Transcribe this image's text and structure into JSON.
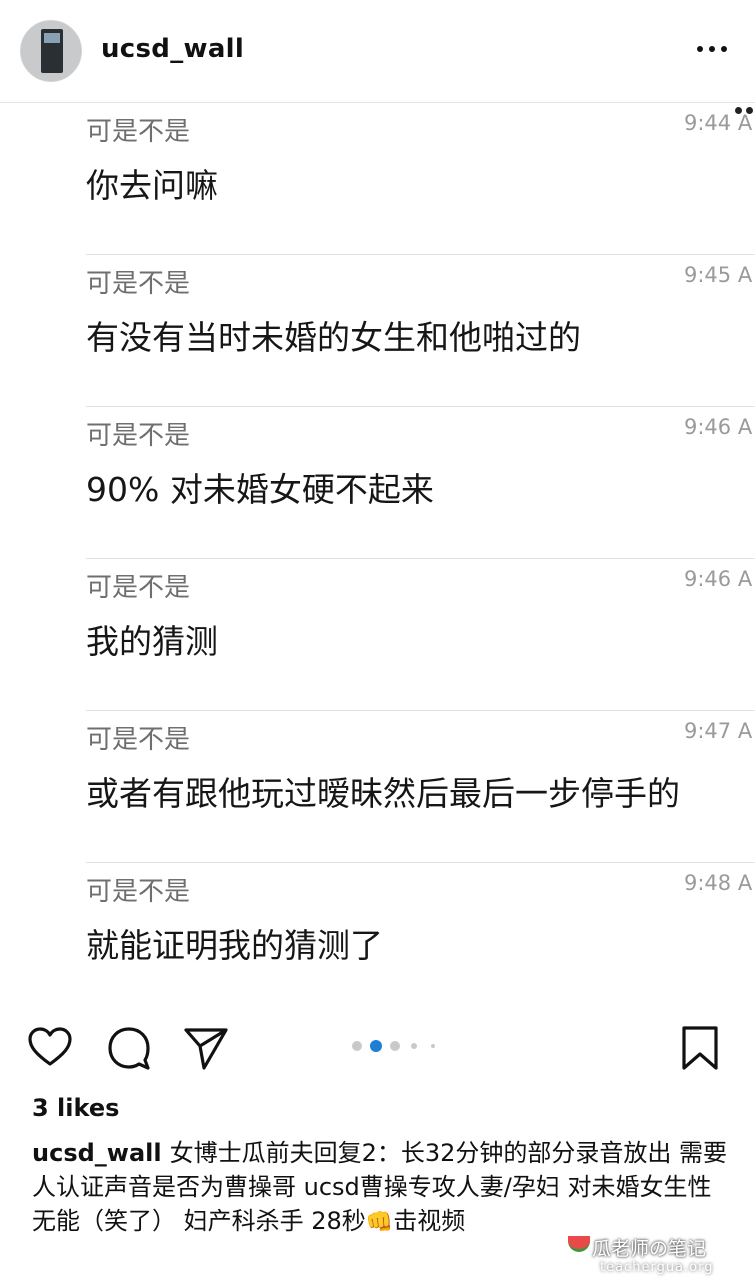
{
  "header": {
    "username": "ucsd_wall",
    "avatar_icon": "profile-photo",
    "more_icon": "more-horizontal-icon"
  },
  "chat": {
    "messages": [
      {
        "sender": "可是不是",
        "time": "9:44 A",
        "text": "你去问嘛"
      },
      {
        "sender": "可是不是",
        "time": "9:45 A",
        "text": "有没有当时未婚的女生和他啪过的"
      },
      {
        "sender": "可是不是",
        "time": "9:46 A",
        "text": "90% 对未婚女硬不起来"
      },
      {
        "sender": "可是不是",
        "time": "9:46 A",
        "text": "我的猜测"
      },
      {
        "sender": "可是不是",
        "time": "9:47 A",
        "text": "或者有跟他玩过暧昧然后最后一步停手的"
      },
      {
        "sender": "可是不是",
        "time": "9:48 A",
        "text": "就能证明我的猜测了"
      }
    ]
  },
  "actions": {
    "like_icon": "heart-icon",
    "comment_icon": "comment-icon",
    "share_icon": "send-icon",
    "save_icon": "bookmark-icon",
    "carousel_active_index": 2,
    "carousel_dots": 5
  },
  "post": {
    "likes": "3 likes",
    "caption_user": "ucsd_wall",
    "caption_text": "女博士瓜前夫回复2：长32分钟的部分录音放出 需要人认证声音是否为曹操哥 ucsd曹操专攻人妻/孕妇 对未婚女生性无能（笑了） 妇产科杀手 28秒",
    "caption_emoji": "👊",
    "caption_tail": "击视频"
  },
  "watermark": {
    "line1": "瓜老师の笔记",
    "line2": "teachergua.org"
  },
  "colors": {
    "text": "#111111",
    "muted": "#6f6f6f",
    "active_dot": "#1e7ed3",
    "inactive_dot": "#c9c9c9"
  }
}
